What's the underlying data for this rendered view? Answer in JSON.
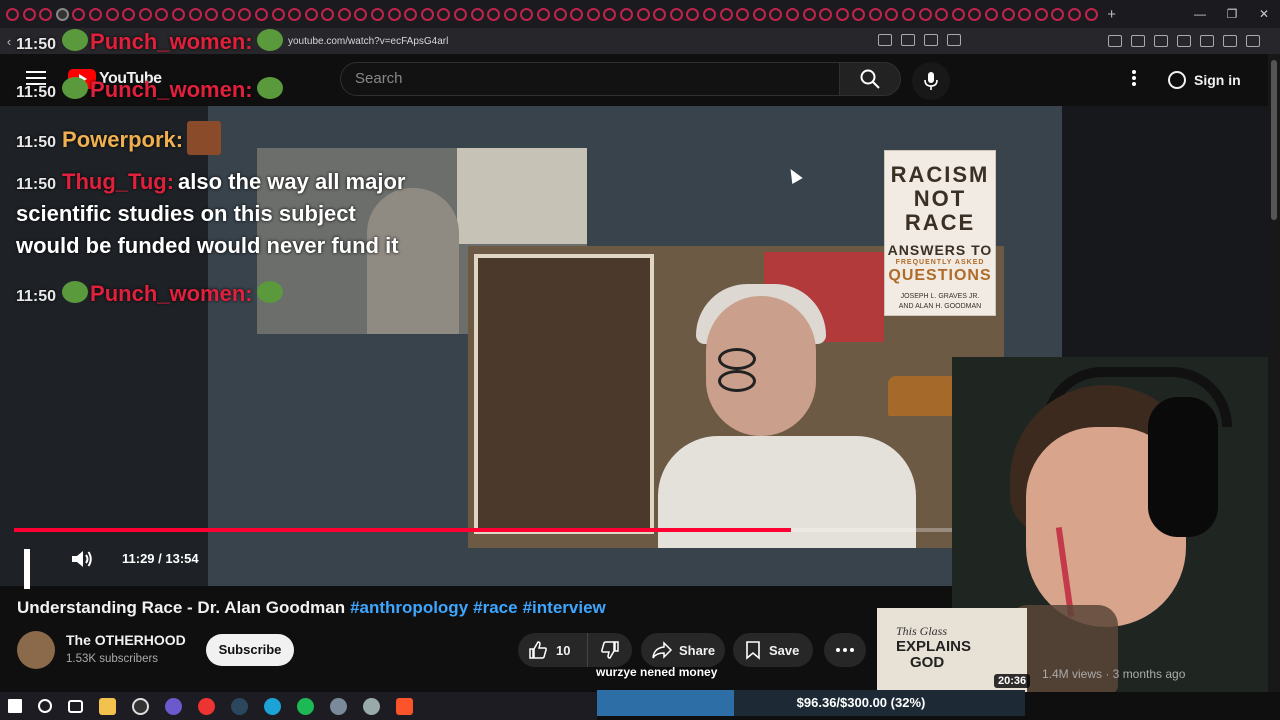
{
  "browser": {
    "url": "youtube.com/watch?v=ecFApsG4arl",
    "open_tab_count": 66
  },
  "youtube": {
    "logo_text": "YouTube",
    "search_placeholder": "Search",
    "sign_in_label": "Sign in"
  },
  "player": {
    "current_time": "11:29",
    "duration": "13:54",
    "timecode": "11:29 / 13:54",
    "progress_fraction": 0.828
  },
  "book_cover": {
    "line1": "RACISM",
    "line2": "NOT RACE",
    "line3": "ANSWERS TO",
    "line4": "FREQUENTLY ASKED",
    "line5": "QUESTIONS",
    "authors_1": "JOSEPH L. GRAVES JR.",
    "authors_2": "AND ALAN H. GOODMAN"
  },
  "chat": [
    {
      "time": "11:50",
      "user": "Punch_women:",
      "user_color": "#e0203c",
      "message": ""
    },
    {
      "time": "11:50",
      "user": "Punch_women:",
      "user_color": "#e0203c",
      "message": ""
    },
    {
      "time": "11:50",
      "user": "Powerpork:",
      "user_color": "#f0b050",
      "message": ""
    },
    {
      "time": "11:50",
      "user": "Thug_Tug:",
      "user_color": "#e0203c",
      "message": "also the way all major"
    },
    {
      "time": "",
      "user": "",
      "user_color": "#ffffff",
      "message": "scientific studies on this subject"
    },
    {
      "time": "",
      "user": "",
      "user_color": "#ffffff",
      "message": "would be funded would never fund it"
    },
    {
      "time": "11:50",
      "user": "Punch_women:",
      "user_color": "#e0203c",
      "message": ""
    }
  ],
  "video": {
    "title": "Understanding Race - Dr. Alan Goodman",
    "tags": [
      "#anthropology",
      "#race",
      "#interview"
    ],
    "channel_name": "The OTHERHOOD",
    "channel_subs": "1.53K subscribers",
    "subscribe_label": "Subscribe",
    "like_count": "10",
    "share_label": "Share",
    "save_label": "Save"
  },
  "recommended": {
    "thumb_line1": "This Glass",
    "thumb_line2": "EXPLAINS",
    "thumb_line3": "GOD",
    "duration": "20:36",
    "meta": "1.4M views · 3 months ago"
  },
  "stream_overlay": {
    "subtitle_text": "wurzye nened money",
    "donation_text": "$96.36/$300.00 (32%)",
    "donation_fraction": 0.32
  },
  "colors": {
    "accent_red": "#ff0033",
    "link_blue": "#3ea6ff",
    "background": "#0f0f0f"
  }
}
